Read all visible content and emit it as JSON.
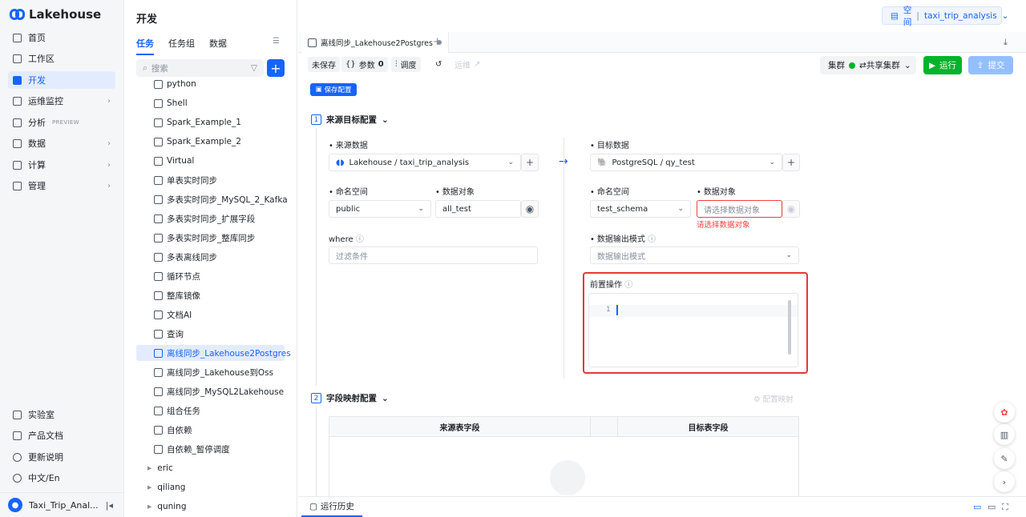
{
  "brand": {
    "name": "Lakehouse",
    "accent": "#1664ff"
  },
  "nav": {
    "items": [
      {
        "label": "首页",
        "icon": "home-icon"
      },
      {
        "label": "工作区",
        "icon": "cube-icon"
      },
      {
        "label": "开发",
        "icon": "terminal-icon",
        "active": true
      },
      {
        "label": "运维监控",
        "icon": "monitor-icon"
      },
      {
        "label": "分析",
        "icon": "chart-icon",
        "badge": "PREVIEW"
      },
      {
        "label": "数据",
        "icon": "database-icon"
      },
      {
        "label": "计算",
        "icon": "compute-icon"
      },
      {
        "label": "管理",
        "icon": "manage-icon"
      }
    ],
    "bottom": [
      {
        "label": "实验室",
        "icon": "flask-icon"
      },
      {
        "label": "产品文档",
        "icon": "book-icon"
      },
      {
        "label": "更新说明",
        "icon": "info-icon"
      },
      {
        "label": "中文/En",
        "icon": "globe-icon"
      }
    ],
    "user": {
      "initial": "",
      "label": "Taxi_Trip_Anal..."
    }
  },
  "tree": {
    "title": "开发",
    "tabs": [
      "任务",
      "任务组",
      "数据"
    ],
    "search_placeholder": "搜索",
    "items": [
      "python",
      "Shell",
      "Spark_Example_1",
      "Spark_Example_2",
      "Virtual",
      "单表实时同步",
      "多表实时同步_MySQL_2_Kafka",
      "多表实时同步_扩展字段",
      "多表实时同步_整库同步",
      "多表离线同步",
      "循环节点",
      "整库镜像",
      "文档AI",
      "查询",
      "离线同步_Lakehouse2Postgres",
      "离线同步_Lakehouse到Oss",
      "离线同步_MySQL2Lakehouse",
      "组合任务",
      "自依赖",
      "自依赖_暂停调度"
    ],
    "folders": [
      "eric",
      "qiliang",
      "quning"
    ]
  },
  "header": {
    "space_label": "空间",
    "space_name": "taxi_trip_analysis"
  },
  "editor": {
    "tab_title": "离线同步_Lakehouse2Postgres",
    "toolbar": {
      "unsaved": "未保存",
      "params": "参数",
      "params_count": "0",
      "schedule": "调度",
      "ops": "运维"
    },
    "cluster_label": "集群",
    "cluster_value": "⇄共享集群",
    "run": "运行",
    "submit": "提交",
    "save_config": "保存配置",
    "section1": {
      "num": "1",
      "title": "来源目标配置"
    },
    "source": {
      "data_label": "来源数据",
      "data_value": "Lakehouse / taxi_trip_analysis",
      "ns_label": "命名空间",
      "ns_value": "public",
      "obj_label": "数据对象",
      "obj_value": "all_test",
      "where_label": "where",
      "where_placeholder": "过滤条件"
    },
    "target": {
      "data_label": "目标数据",
      "data_value": "PostgreSQL / qy_test",
      "ns_label": "命名空间",
      "ns_value": "test_schema",
      "obj_label": "数据对象",
      "obj_placeholder": "请选择数据对象",
      "obj_error": "请选择数据对象",
      "mode_label": "数据输出模式",
      "mode_placeholder": "数据输出模式",
      "preop_label": "前置操作",
      "line_no": "1"
    },
    "section2": {
      "num": "2",
      "title": "字段映射配置",
      "config_mapping": "配置映射"
    },
    "mapping_headers": [
      "来源表字段",
      "目标表字段"
    ],
    "bottom_tab": "运行历史"
  }
}
